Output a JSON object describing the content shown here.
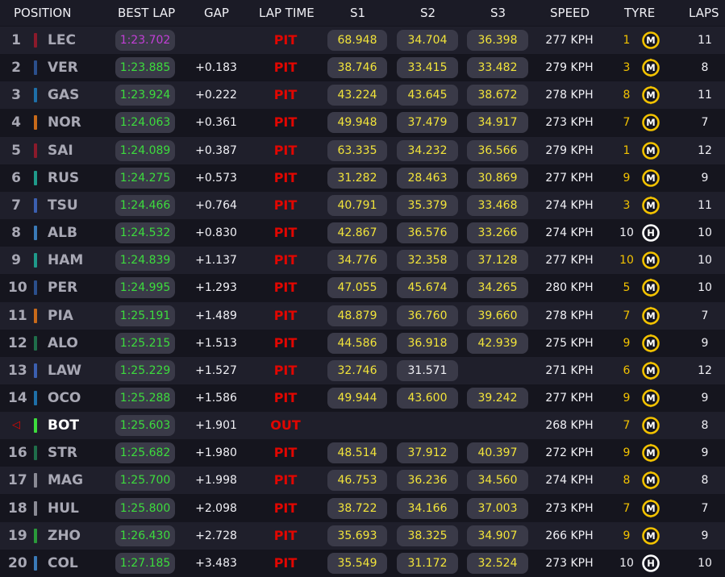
{
  "header": {
    "position": "POSITION",
    "best_lap": "BEST LAP",
    "gap": "GAP",
    "lap_time": "LAP TIME",
    "s1": "S1",
    "s2": "S2",
    "s3": "S3",
    "speed": "SPEED",
    "tyre": "TYRE",
    "laps": "LAPS"
  },
  "colors": {
    "purple_sector": "#c23fd6",
    "green_sector": "#3ddc3d",
    "yellow_sector": "#f2e43a",
    "pit": "#e10600",
    "medium_tyre": "#f2c200",
    "hard_tyre": "#ffffff"
  },
  "rows": [
    {
      "pos": "1",
      "marker": false,
      "team_color": "#8b1a2b",
      "driver": "LEC",
      "best": "1:23.702",
      "best_purple": true,
      "gap": "",
      "lap_time": "PIT",
      "s1": "68.948",
      "s2": "34.704",
      "s3": "36.398",
      "speed": "277 KPH",
      "age": "1",
      "age_white": false,
      "tyre": "M",
      "tyre_new": false,
      "laps": "11"
    },
    {
      "pos": "2",
      "marker": false,
      "team_color": "#2b4f8c",
      "driver": "VER",
      "best": "1:23.885",
      "best_purple": false,
      "gap": "+0.183",
      "lap_time": "PIT",
      "s1": "38.746",
      "s2": "33.415",
      "s3": "33.482",
      "speed": "279 KPH",
      "age": "3",
      "age_white": false,
      "tyre": "M",
      "tyre_new": true,
      "laps": "8"
    },
    {
      "pos": "3",
      "marker": false,
      "team_color": "#1e6fa8",
      "driver": "GAS",
      "best": "1:23.924",
      "best_purple": false,
      "gap": "+0.222",
      "lap_time": "PIT",
      "s1": "43.224",
      "s2": "43.645",
      "s3": "38.672",
      "speed": "278 KPH",
      "age": "8",
      "age_white": false,
      "tyre": "M",
      "tyre_new": true,
      "laps": "11"
    },
    {
      "pos": "4",
      "marker": false,
      "team_color": "#c86a1a",
      "driver": "NOR",
      "best": "1:24.063",
      "best_purple": false,
      "gap": "+0.361",
      "lap_time": "PIT",
      "s1": "49.948",
      "s2": "37.479",
      "s3": "34.917",
      "speed": "273 KPH",
      "age": "7",
      "age_white": false,
      "tyre": "M",
      "tyre_new": false,
      "laps": "7"
    },
    {
      "pos": "5",
      "marker": false,
      "team_color": "#8b1a2b",
      "driver": "SAI",
      "best": "1:24.089",
      "best_purple": false,
      "gap": "+0.387",
      "lap_time": "PIT",
      "s1": "63.335",
      "s2": "34.232",
      "s3": "36.566",
      "speed": "279 KPH",
      "age": "1",
      "age_white": false,
      "tyre": "M",
      "tyre_new": false,
      "laps": "12"
    },
    {
      "pos": "6",
      "marker": false,
      "team_color": "#1f9a8a",
      "driver": "RUS",
      "best": "1:24.275",
      "best_purple": false,
      "gap": "+0.573",
      "lap_time": "PIT",
      "s1": "31.282",
      "s2": "28.463",
      "s3": "30.869",
      "speed": "277 KPH",
      "age": "9",
      "age_white": false,
      "tyre": "M",
      "tyre_new": false,
      "laps": "9"
    },
    {
      "pos": "7",
      "marker": false,
      "team_color": "#3b5fb0",
      "driver": "TSU",
      "best": "1:24.466",
      "best_purple": false,
      "gap": "+0.764",
      "lap_time": "PIT",
      "s1": "40.791",
      "s2": "35.379",
      "s3": "33.468",
      "speed": "274 KPH",
      "age": "3",
      "age_white": false,
      "tyre": "M",
      "tyre_new": true,
      "laps": "11"
    },
    {
      "pos": "8",
      "marker": false,
      "team_color": "#3a7ab8",
      "driver": "ALB",
      "best": "1:24.532",
      "best_purple": false,
      "gap": "+0.830",
      "lap_time": "PIT",
      "s1": "42.867",
      "s2": "36.576",
      "s3": "33.266",
      "speed": "274 KPH",
      "age": "10",
      "age_white": true,
      "tyre": "H",
      "tyre_new": false,
      "laps": "10"
    },
    {
      "pos": "9",
      "marker": false,
      "team_color": "#1f9a8a",
      "driver": "HAM",
      "best": "1:24.839",
      "best_purple": false,
      "gap": "+1.137",
      "lap_time": "PIT",
      "s1": "34.776",
      "s2": "32.358",
      "s3": "37.128",
      "speed": "277 KPH",
      "age": "10",
      "age_white": false,
      "tyre": "M",
      "tyre_new": false,
      "laps": "10"
    },
    {
      "pos": "10",
      "marker": false,
      "team_color": "#2b4f8c",
      "driver": "PER",
      "best": "1:24.995",
      "best_purple": false,
      "gap": "+1.293",
      "lap_time": "PIT",
      "s1": "47.055",
      "s2": "45.674",
      "s3": "34.265",
      "speed": "280 KPH",
      "age": "5",
      "age_white": false,
      "tyre": "M",
      "tyre_new": true,
      "laps": "10"
    },
    {
      "pos": "11",
      "marker": false,
      "team_color": "#c86a1a",
      "driver": "PIA",
      "best": "1:25.191",
      "best_purple": false,
      "gap": "+1.489",
      "lap_time": "PIT",
      "s1": "48.879",
      "s2": "36.760",
      "s3": "39.660",
      "speed": "278 KPH",
      "age": "7",
      "age_white": false,
      "tyre": "M",
      "tyre_new": true,
      "laps": "7"
    },
    {
      "pos": "12",
      "marker": false,
      "team_color": "#1f6e4a",
      "driver": "ALO",
      "best": "1:25.215",
      "best_purple": false,
      "gap": "+1.513",
      "lap_time": "PIT",
      "s1": "44.586",
      "s2": "36.918",
      "s3": "42.939",
      "speed": "275 KPH",
      "age": "9",
      "age_white": false,
      "tyre": "M",
      "tyre_new": true,
      "laps": "9"
    },
    {
      "pos": "13",
      "marker": false,
      "team_color": "#3b5fb0",
      "driver": "LAW",
      "best": "1:25.229",
      "best_purple": false,
      "gap": "+1.527",
      "lap_time": "PIT",
      "s1": "32.746",
      "s2": "31.571",
      "s3": "",
      "s2_white": true,
      "speed": "271 KPH",
      "age": "6",
      "age_white": false,
      "tyre": "M",
      "tyre_new": true,
      "laps": "12"
    },
    {
      "pos": "14",
      "marker": false,
      "team_color": "#1e6fa8",
      "driver": "OCO",
      "best": "1:25.288",
      "best_purple": false,
      "gap": "+1.586",
      "lap_time": "PIT",
      "s1": "49.944",
      "s2": "43.600",
      "s3": "39.242",
      "speed": "277 KPH",
      "age": "9",
      "age_white": false,
      "tyre": "M",
      "tyre_new": true,
      "laps": "9"
    },
    {
      "pos": "",
      "marker": true,
      "team_color": "#3ddc3d",
      "driver": "BOT",
      "best": "1:25.603",
      "best_purple": false,
      "gap": "+1.901",
      "lap_time": "OUT",
      "s1": "",
      "s2": "",
      "s3": "",
      "speed": "268 KPH",
      "age": "7",
      "age_white": false,
      "tyre": "M",
      "tyre_new": false,
      "laps": "8",
      "highlight": true
    },
    {
      "pos": "16",
      "marker": false,
      "team_color": "#1f6e4a",
      "driver": "STR",
      "best": "1:25.682",
      "best_purple": false,
      "gap": "+1.980",
      "lap_time": "PIT",
      "s1": "48.514",
      "s2": "37.912",
      "s3": "40.397",
      "speed": "272 KPH",
      "age": "9",
      "age_white": false,
      "tyre": "M",
      "tyre_new": true,
      "laps": "9"
    },
    {
      "pos": "17",
      "marker": false,
      "team_color": "#8a8a94",
      "driver": "MAG",
      "best": "1:25.700",
      "best_purple": false,
      "gap": "+1.998",
      "lap_time": "PIT",
      "s1": "46.753",
      "s2": "36.236",
      "s3": "34.560",
      "speed": "274 KPH",
      "age": "8",
      "age_white": false,
      "tyre": "M",
      "tyre_new": true,
      "laps": "8"
    },
    {
      "pos": "18",
      "marker": false,
      "team_color": "#8a8a94",
      "driver": "HUL",
      "best": "1:25.800",
      "best_purple": false,
      "gap": "+2.098",
      "lap_time": "PIT",
      "s1": "38.722",
      "s2": "34.166",
      "s3": "37.003",
      "speed": "273 KPH",
      "age": "7",
      "age_white": false,
      "tyre": "M",
      "tyre_new": true,
      "laps": "7"
    },
    {
      "pos": "19",
      "marker": false,
      "team_color": "#2a9a3a",
      "driver": "ZHO",
      "best": "1:26.430",
      "best_purple": false,
      "gap": "+2.728",
      "lap_time": "PIT",
      "s1": "35.693",
      "s2": "38.325",
      "s3": "34.907",
      "speed": "266 KPH",
      "age": "9",
      "age_white": false,
      "tyre": "M",
      "tyre_new": false,
      "laps": "9"
    },
    {
      "pos": "20",
      "marker": false,
      "team_color": "#3a7ab8",
      "driver": "COL",
      "best": "1:27.185",
      "best_purple": false,
      "gap": "+3.483",
      "lap_time": "PIT",
      "s1": "35.549",
      "s2": "31.172",
      "s3": "32.524",
      "speed": "273 KPH",
      "age": "10",
      "age_white": true,
      "tyre": "H",
      "tyre_new": false,
      "laps": "10"
    }
  ]
}
